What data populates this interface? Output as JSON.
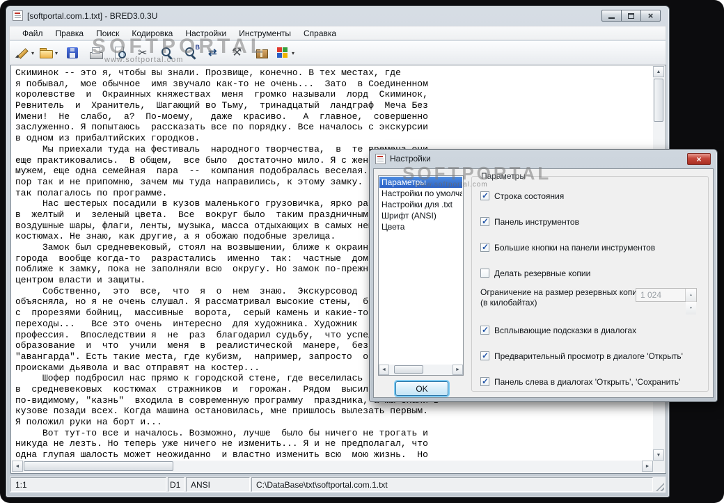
{
  "window": {
    "title": "[softportal.com.1.txt] - BRED3.0.3U",
    "menu": [
      "Файл",
      "Правка",
      "Поиск",
      "Кодировка",
      "Настройки",
      "Инструменты",
      "Справка"
    ],
    "toolbar": [
      {
        "name": "new-file",
        "dropdown": true
      },
      {
        "name": "open-file",
        "dropdown": true
      },
      {
        "name": "save-file"
      },
      {
        "name": "print"
      },
      {
        "name": "preview"
      },
      {
        "name": "cut"
      },
      {
        "name": "find"
      },
      {
        "name": "find-next",
        "badge": "B"
      },
      {
        "name": "replace"
      },
      {
        "name": "tools"
      },
      {
        "name": "plugins"
      },
      {
        "name": "start-menu",
        "dropdown": true
      }
    ],
    "editor_lines": [
      "Скиминок -- это я, чтобы вы знали. Прозвище, конечно. В тех местах, где",
      "я побывал,  мое обычное  имя звучало как-то не очень...  Зато  в Соединенном",
      "королевстве  и  Окраинных княжествах  меня  громко называли  лорд  Скиминок,",
      "Ревнитель  и  Хранитель,  Шагающий во Тьму,  тринадцатый  ландграф  Меча Без",
      "Имени!  Не  слабо,  а?  По-моему,   даже  красиво.   А  главное,  совершенно",
      "заслуженно. Я попытаюсь  рассказать все по порядку. Все началось с экскурсии",
      "в одном из прибалтийских городков.",
      "     Мы приехали туда на фестиваль  народного творчества,  в  те времена они",
      "еще практиковались.  В общем,  все было  достаточно мило. Я с женой, подруга с",
      "мужем, еще одна семейная  пара  --  компания подобралась веселая. До сих",
      "пор так и не припомню, зачем мы туда направились, к этому замку. Наверное,",
      "так полагалось по программе.",
      "     Нас шестерых посадили в кузов маленького грузовичка, ярко раскрашенного",
      "в  желтый  и  зеленый цвета.  Все  вокруг было  таким праздничным и ярким:",
      "воздушные шары, флаги, ленты, музыка, масса отдыхающих в самых немыслимых",
      "костюмах. Не знаю, как другие, а я обожаю подобные зрелища.",
      "     Замок был средневековый, стоял на возвышении, ближе к окраине. Такие",
      "города  вообще когда-то  разрастались  именно  так:  частные  домики лепились",
      "поближе к замку, пока не заполняли всю  округу. Но замок по-прежнему оставался",
      "центром власти и защиты.",
      "     Собственно,  это  все,  что  я  о  нем  знаю.  Экскурсовод  что-то  еще",
      "объясняла, но я не очень слушал. Я рассматривал высокие стены,  башни",
      "с  прорезями бойниц,  массивные  ворота,  серый камень и какие-то навесные",
      "переходы...   Все это очень  интересно  для художника. Художник  --  это моя",
      "профессия.  Впоследствии я  не  раз  благодарил судьбу,  что успел получить",
      "образование  и  что  учили  меня  в  реалистической  манере,  без",
      "\"авангарда\". Есть такие места, где кубизм,  например, запросто  объявят",
      "происками дьявола и вас отправят на костер...",
      "     Шофер подбросил нас прямо к городской стене, где веселилась  толпа людей",
      "в  средневековых  костюмах  стражников  и  горожан.  Рядом  высился  эшафот,",
      "по-видимому, \"казнь\"  входила в современную программу  праздника, а мы ехали в",
      "кузове позади всех. Когда машина остановилась, мне пришлось вылезать первым.",
      "Я положил руки на борт и...",
      "     Вот тут-то все и началось. Возможно, лучше  было бы ничего не трогать и",
      "никуда не лезть. Но теперь уже ничего не изменить... Я и не предполагал, что",
      "одна глупая шалость может неожиданно  и властно изменить всю  мою жизнь.  Но"
    ],
    "statusbar": {
      "cursor": "1:1",
      "panel2": "D1",
      "encoding": "ANSI",
      "file_path": "C:\\DataBase\\txt\\softportal.com.1.txt"
    },
    "watermark": {
      "title": "SOFTPORTAL",
      "url": "www.softportal.com"
    }
  },
  "dialog": {
    "title": "Настройки",
    "categories": [
      {
        "label": "Параметры",
        "selected": true
      },
      {
        "label": "Настройки по умолчанию"
      },
      {
        "label": "Настройки для .txt"
      },
      {
        "label": "Шрифт (ANSI)"
      },
      {
        "label": "Цвета"
      }
    ],
    "ok_label": "OK",
    "group_label": "Параметры",
    "options_top": [
      {
        "label": "Строка состояния",
        "checked": true
      },
      {
        "label": "Панель инструментов",
        "checked": true
      },
      {
        "label": "Большие кнопки на панели инструментов",
        "checked": true
      },
      {
        "label": "Делать резервные копии",
        "checked": false
      }
    ],
    "backup_limit": {
      "label": "Ограничение на размер резервных копий (в килобайтах)",
      "value": "1 024"
    },
    "options_bottom": [
      {
        "label": "Всплывающие подсказки в диалогах",
        "checked": true
      },
      {
        "label": "Предварительный просмотр в диалоге 'Открыть'",
        "checked": true
      },
      {
        "label": "Панель слева в диалогах 'Открыть', 'Сохранить'",
        "checked": true
      }
    ],
    "watermark": {
      "title": "SOFTPORTAL",
      "url": "www.softportal.com"
    }
  },
  "colors": {
    "check": "#2456a8",
    "selection": "#2e6fd6",
    "default-glow": "#41b0f0",
    "close-red": "#b4372a"
  }
}
